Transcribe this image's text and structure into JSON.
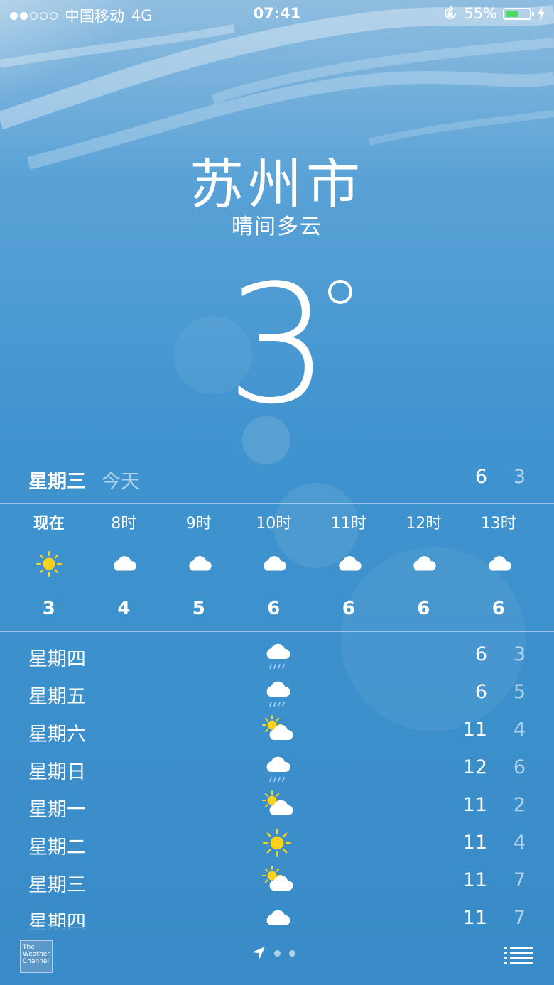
{
  "status_bar": {
    "carrier": "中国移动",
    "network": "4G",
    "time": "07:41",
    "battery_text": "55%",
    "battery_level": 0.55
  },
  "location": {
    "city": "苏州市",
    "condition": "晴间多云",
    "temperature": "3"
  },
  "today": {
    "day": "星期三",
    "label": "今天",
    "high": "6",
    "low": "3"
  },
  "hourly": [
    {
      "time": "现在",
      "icon": "sun-icon",
      "temp": "3"
    },
    {
      "time": "8时",
      "icon": "cloud-icon",
      "temp": "4"
    },
    {
      "time": "9时",
      "icon": "cloud-icon",
      "temp": "5"
    },
    {
      "time": "10时",
      "icon": "cloud-icon",
      "temp": "6"
    },
    {
      "time": "11时",
      "icon": "cloud-icon",
      "temp": "6"
    },
    {
      "time": "12时",
      "icon": "cloud-icon",
      "temp": "6"
    },
    {
      "time": "13时",
      "icon": "cloud-icon",
      "temp": "6"
    }
  ],
  "daily": [
    {
      "day": "星期四",
      "icon": "rain-cloud-icon",
      "high": "6",
      "low": "3"
    },
    {
      "day": "星期五",
      "icon": "rain-cloud-icon",
      "high": "6",
      "low": "5"
    },
    {
      "day": "星期六",
      "icon": "partly-cloudy-icon",
      "high": "11",
      "low": "4"
    },
    {
      "day": "星期日",
      "icon": "rain-cloud-icon",
      "high": "12",
      "low": "6"
    },
    {
      "day": "星期一",
      "icon": "partly-cloudy-icon",
      "high": "11",
      "low": "2"
    },
    {
      "day": "星期二",
      "icon": "sun-icon",
      "high": "11",
      "low": "4"
    },
    {
      "day": "星期三",
      "icon": "partly-cloudy-icon",
      "high": "11",
      "low": "7"
    },
    {
      "day": "星期四",
      "icon": "cloud-icon",
      "high": "11",
      "low": "7"
    }
  ],
  "bottom_bar": {
    "logo_line1": "The",
    "logo_line2": "Weather",
    "logo_line3": "Channel",
    "page_count": 2
  },
  "colors": {
    "sun": "#ffd21a",
    "battery": "#4cd964",
    "rain": "#9fd0ff"
  }
}
